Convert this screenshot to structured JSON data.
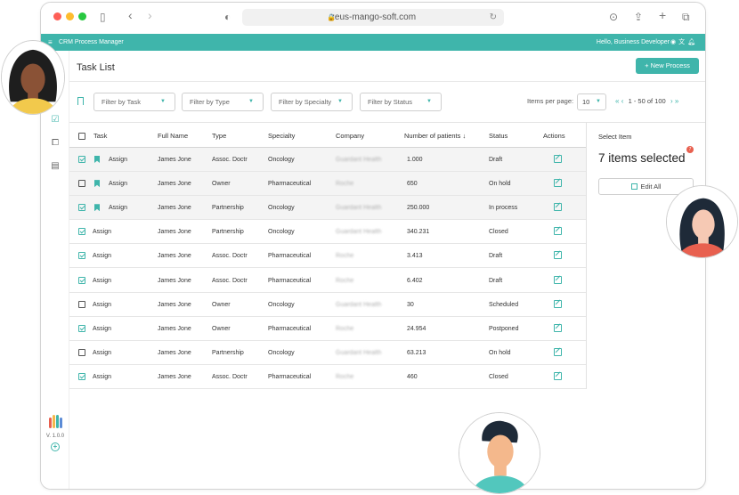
{
  "browser": {
    "url": "zeus-mango-soft.com"
  },
  "appbar": {
    "title": "CRM Process Manager",
    "greeting": "Hello, Business Developer"
  },
  "header": {
    "title": "Task List",
    "new_button": "New Process"
  },
  "filters": [
    {
      "label": "Filter by Task"
    },
    {
      "label": "Filter by Type"
    },
    {
      "label": "Filter by Specialty"
    },
    {
      "label": "Filter by Status"
    }
  ],
  "pagination": {
    "items_per_page_label": "Items per page:",
    "items_per_page": "10",
    "range": "1 - 50 of 100"
  },
  "table": {
    "columns": [
      "Task",
      "Full Name",
      "Type",
      "Specialty",
      "Company",
      "Number of patients",
      "Status",
      "Actions"
    ],
    "sort_indicator": "↓",
    "rows": [
      {
        "task": "Assign",
        "name": "James Jone",
        "type": "Assoc. Doctr",
        "specialty": "Oncology",
        "company": "Guardant Health",
        "patients": "1.000",
        "status": "Draft",
        "checked": true,
        "bookmarked": true
      },
      {
        "task": "Assign",
        "name": "James Jone",
        "type": "Owner",
        "specialty": "Pharmaceutical",
        "company": "Roche",
        "patients": "650",
        "status": "On hold",
        "checked": false,
        "bookmarked": true
      },
      {
        "task": "Assign",
        "name": "James Jone",
        "type": "Partnership",
        "specialty": "Oncology",
        "company": "Guardant Health",
        "patients": "250.000",
        "status": "In process",
        "checked": true,
        "bookmarked": true
      },
      {
        "task": "Assign",
        "name": "James Jone",
        "type": "Partnership",
        "specialty": "Oncology",
        "company": "Guardant Health",
        "patients": "340.231",
        "status": "Closed",
        "checked": true,
        "bookmarked": false
      },
      {
        "task": "Assign",
        "name": "James Jone",
        "type": "Assoc. Doctr",
        "specialty": "Pharmaceutical",
        "company": "Roche",
        "patients": "3.413",
        "status": "Draft",
        "checked": true,
        "bookmarked": false
      },
      {
        "task": "Assign",
        "name": "James Jone",
        "type": "Assoc. Doctr",
        "specialty": "Pharmaceutical",
        "company": "Roche",
        "patients": "6.402",
        "status": "Draft",
        "checked": true,
        "bookmarked": false
      },
      {
        "task": "Assign",
        "name": "James Jone",
        "type": "Owner",
        "specialty": "Oncology",
        "company": "Guardant Health",
        "patients": "30",
        "status": "Scheduled",
        "checked": false,
        "bookmarked": false
      },
      {
        "task": "Assign",
        "name": "James Jone",
        "type": "Owner",
        "specialty": "Pharmaceutical",
        "company": "Roche",
        "patients": "24.954",
        "status": "Postponed",
        "checked": true,
        "bookmarked": false
      },
      {
        "task": "Assign",
        "name": "James Jone",
        "type": "Partnership",
        "specialty": "Oncology",
        "company": "Guardant Health",
        "patients": "63.213",
        "status": "On hold",
        "checked": false,
        "bookmarked": false
      },
      {
        "task": "Assign",
        "name": "James Jone",
        "type": "Assoc. Doctr",
        "specialty": "Pharmaceutical",
        "company": "Roche",
        "patients": "460",
        "status": "Closed",
        "checked": true,
        "bookmarked": false
      }
    ]
  },
  "panel": {
    "label": "Select Item",
    "count_text": "7 items selected",
    "badge": "7",
    "edit_all": "Edit All"
  },
  "sidebar": {
    "version": "V. 1.0.0"
  },
  "colors": {
    "accent": "#3fb5ab",
    "badge": "#e8604f"
  }
}
